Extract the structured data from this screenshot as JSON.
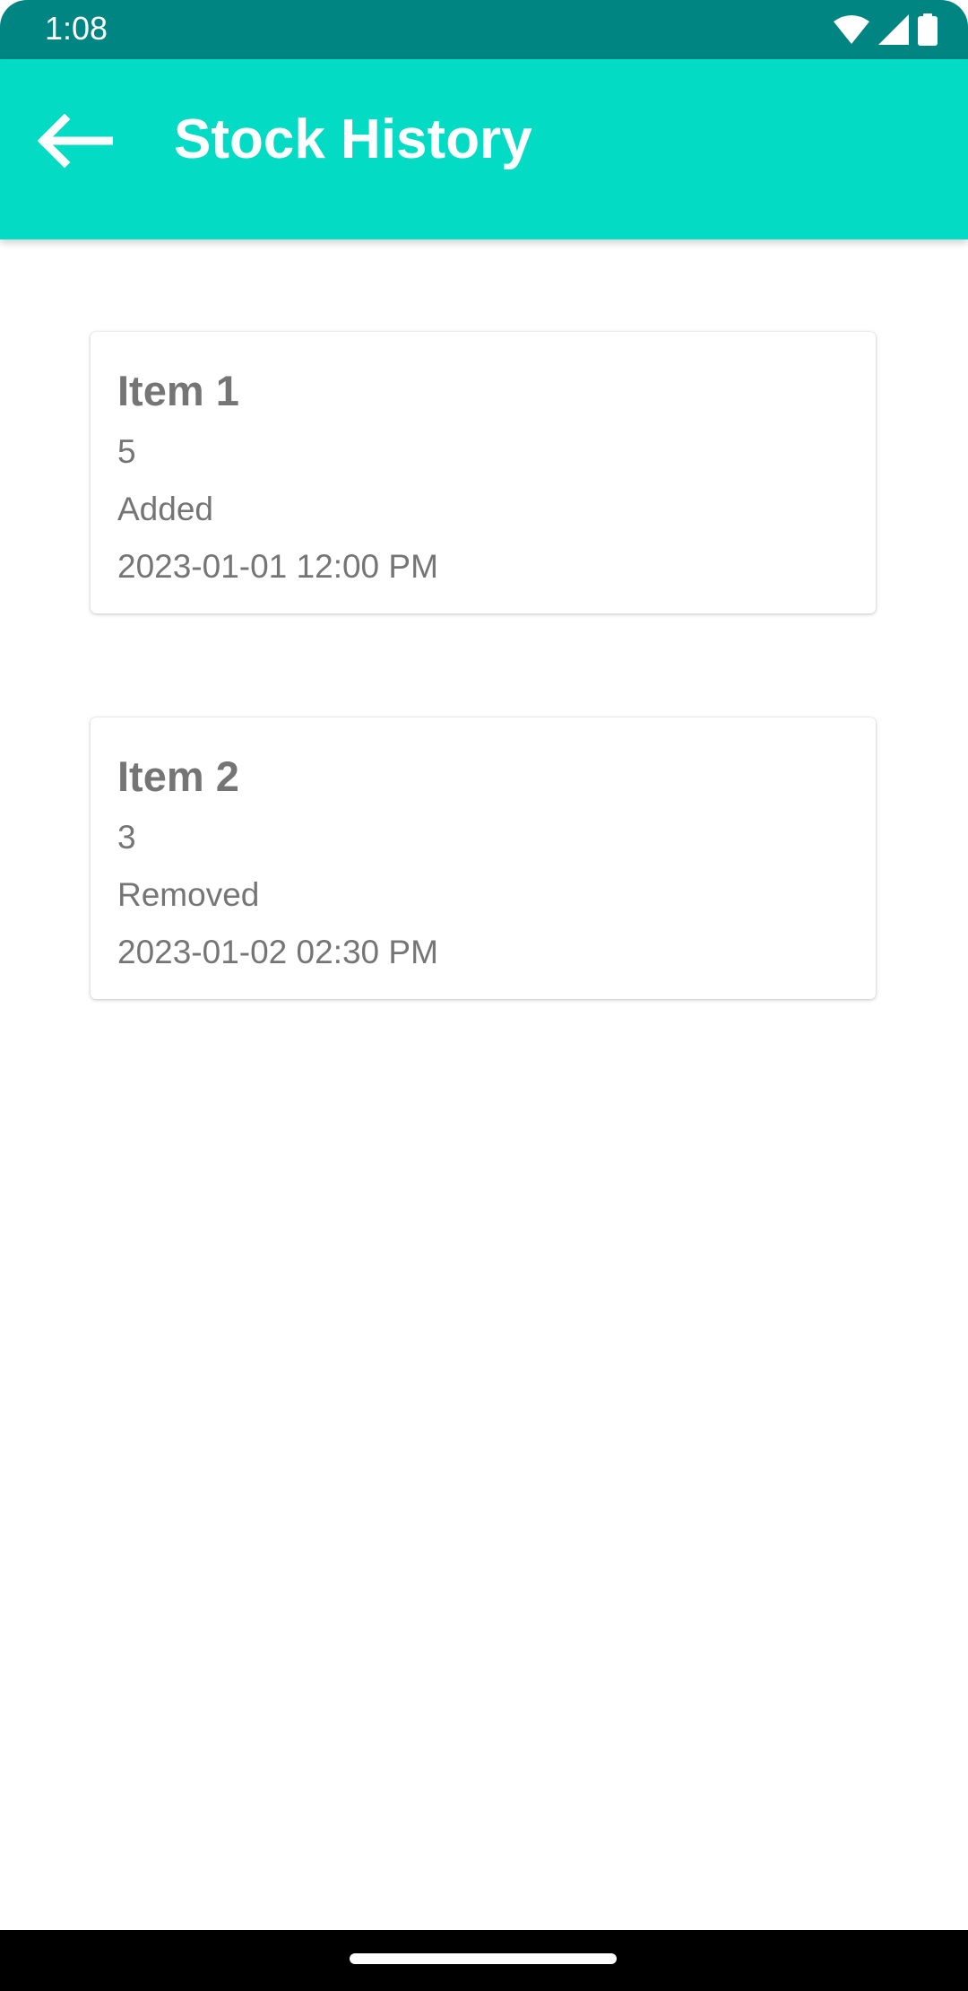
{
  "status_bar": {
    "time": "1:08",
    "icons": [
      "wifi-icon",
      "cellular-signal-icon",
      "battery-icon"
    ],
    "background_color": "#008583"
  },
  "app_bar": {
    "title": "Stock History",
    "back_icon": "arrow-back-icon",
    "background_color": "#03dbc4"
  },
  "history": {
    "items": [
      {
        "name": "Item 1",
        "quantity": "5",
        "action": "Added",
        "timestamp": "2023-01-01 12:00 PM"
      },
      {
        "name": "Item 2",
        "quantity": "3",
        "action": "Removed",
        "timestamp": "2023-01-02 02:30 PM"
      }
    ]
  },
  "nav_bar": {
    "home_indicator": "home-indicator"
  }
}
